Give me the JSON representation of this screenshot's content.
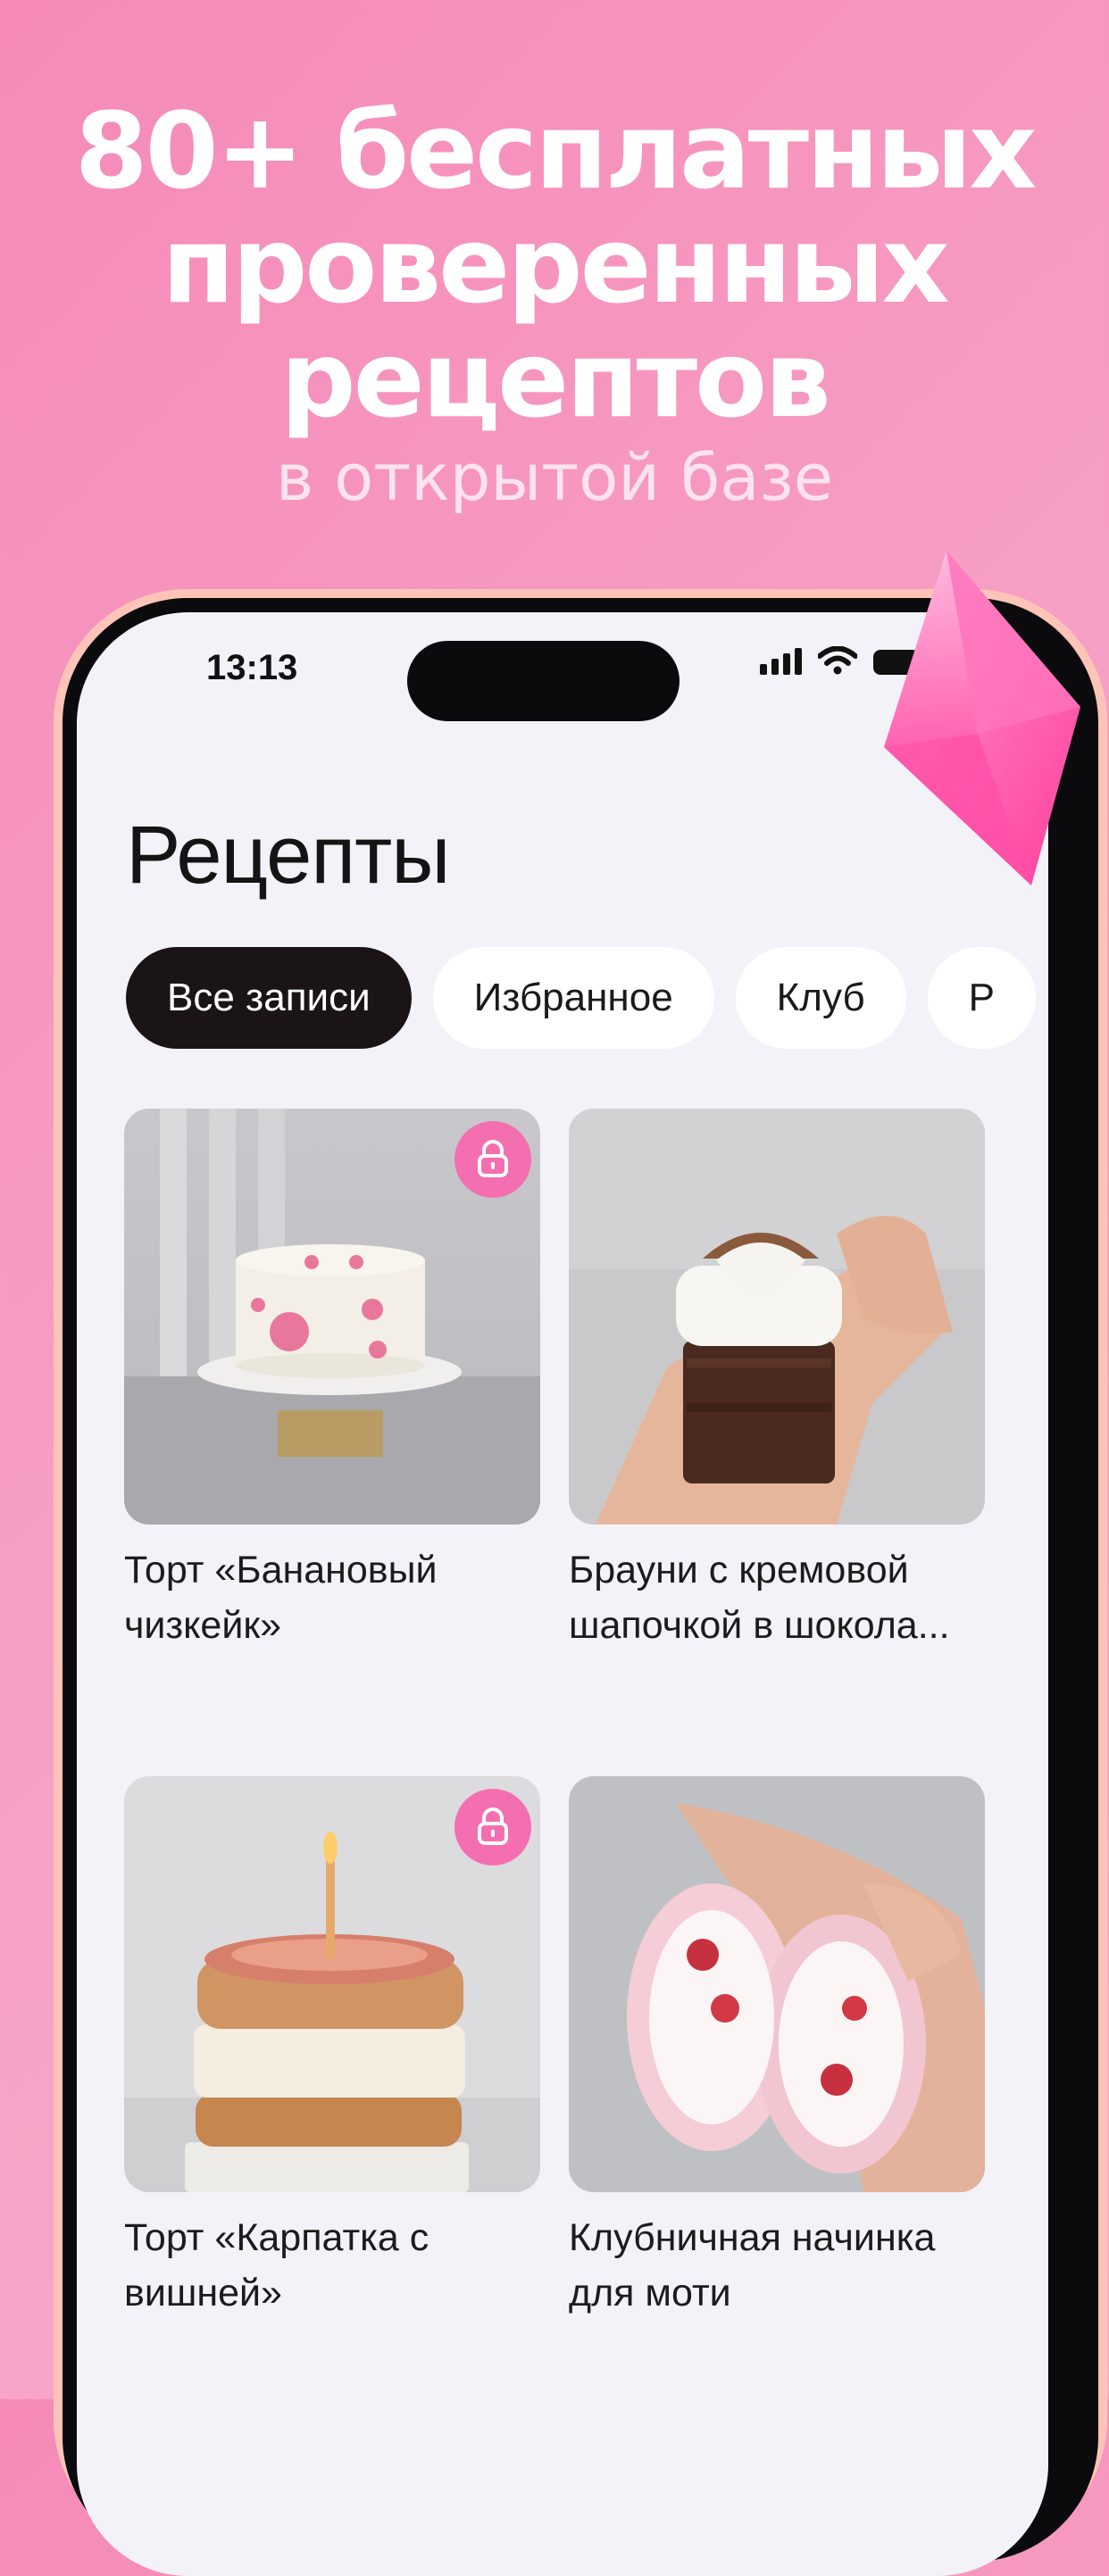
{
  "promo": {
    "title_lines": [
      "80+ бесплатных",
      "проверенных",
      "рецептов"
    ],
    "subtitle": "в открытой базе"
  },
  "status_bar": {
    "time": "13:13",
    "icons": [
      "signal-icon",
      "wifi-icon",
      "battery-icon"
    ]
  },
  "screen": {
    "title": "Рецепты",
    "tabs": [
      {
        "label": "Все записи",
        "active": true
      },
      {
        "label": "Избранное",
        "active": false
      },
      {
        "label": "Клуб",
        "active": false
      },
      {
        "label": "Р",
        "active": false
      }
    ],
    "recipes": [
      {
        "title": "Торт «Банановый чизкейк»",
        "locked": true,
        "image": "white-cake-with-pink-flowers-photo"
      },
      {
        "title": "Брауни с кремовой шапочкой в шокола...",
        "locked": false,
        "image": "hand-holding-brownie-photo"
      },
      {
        "title": "Торт «Карпатка с вишней»",
        "locked": true,
        "image": "layered-choux-cake-with-candle-photo"
      },
      {
        "title": "Клубничная начинка для моти",
        "locked": false,
        "image": "hand-holding-strawberry-mochi-photo"
      }
    ]
  },
  "colors": {
    "background": "#f58ab8",
    "accent_pink": "#f46fb0",
    "active_chip": "#1a1416",
    "screen_bg": "#f3f2f8"
  }
}
